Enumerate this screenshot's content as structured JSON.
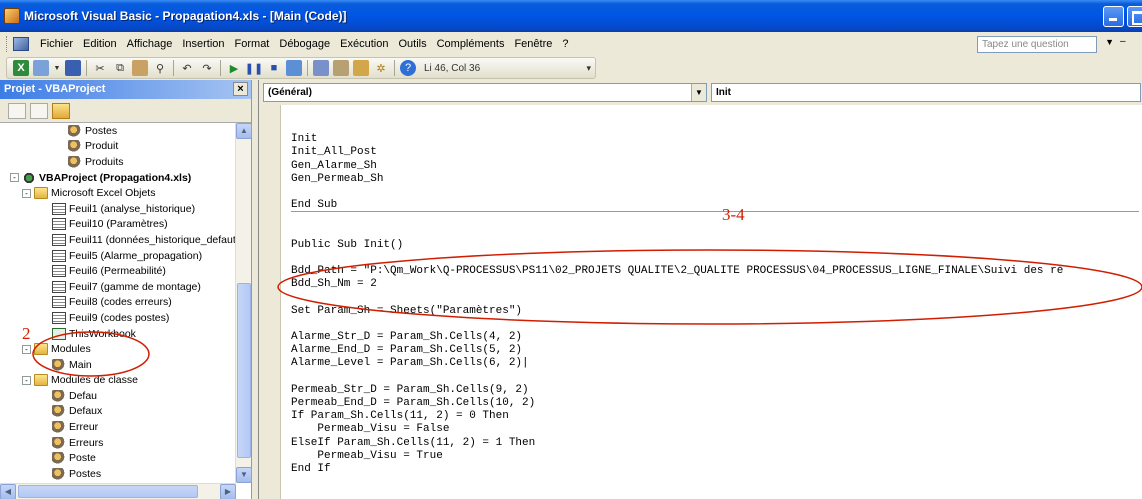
{
  "window": {
    "title": "Microsoft Visual Basic - Propagation4.xls - [Main (Code)]"
  },
  "menu": {
    "items": [
      "Fichier",
      "Edition",
      "Affichage",
      "Insertion",
      "Format",
      "Débogage",
      "Exécution",
      "Outils",
      "Compléments",
      "Fenêtre",
      "?"
    ],
    "question_placeholder": "Tapez une question"
  },
  "toolbar": {
    "position": "Li 46, Col 36"
  },
  "project": {
    "title": "Projet - VBAProject",
    "tree": [
      {
        "label": "Postes",
        "icon": "module-icon",
        "level": 3
      },
      {
        "label": "Produit",
        "icon": "module-icon",
        "level": 3
      },
      {
        "label": "Produits",
        "icon": "module-icon",
        "level": 3
      },
      {
        "label": "VBAProject (Propagation4.xls)",
        "icon": "project-icon",
        "level": 0,
        "bold": true,
        "expander": "-"
      },
      {
        "label": "Microsoft Excel Objets",
        "icon": "folder-icon",
        "level": 1,
        "expander": "-"
      },
      {
        "label": "Feuil1 (analyse_historique)",
        "icon": "sheet-icon",
        "level": 2
      },
      {
        "label": "Feuil10 (Paramètres)",
        "icon": "sheet-icon",
        "level": 2
      },
      {
        "label": "Feuil11 (données_historique_defaut",
        "icon": "sheet-icon",
        "level": 2
      },
      {
        "label": "Feuil5 (Alarme_propagation)",
        "icon": "sheet-icon",
        "level": 2
      },
      {
        "label": "Feuil6 (Permeabilité)",
        "icon": "sheet-icon",
        "level": 2
      },
      {
        "label": "Feuil7 (gamme de montage)",
        "icon": "sheet-icon",
        "level": 2
      },
      {
        "label": "Feuil8 (codes erreurs)",
        "icon": "sheet-icon",
        "level": 2
      },
      {
        "label": "Feuil9 (codes postes)",
        "icon": "sheet-icon",
        "level": 2
      },
      {
        "label": "ThisWorkbook",
        "icon": "workbook-icon",
        "level": 2
      },
      {
        "label": "Modules",
        "icon": "folder-icon",
        "level": 1,
        "expander": "-"
      },
      {
        "label": "Main",
        "icon": "module-icon",
        "level": 2
      },
      {
        "label": "Modules de classe",
        "icon": "folder-icon",
        "level": 1,
        "expander": "-"
      },
      {
        "label": "Defau",
        "icon": "module-icon",
        "level": 2
      },
      {
        "label": "Defaux",
        "icon": "module-icon",
        "level": 2
      },
      {
        "label": "Erreur",
        "icon": "module-icon",
        "level": 2
      },
      {
        "label": "Erreurs",
        "icon": "module-icon",
        "level": 2
      },
      {
        "label": "Poste",
        "icon": "module-icon",
        "level": 2
      },
      {
        "label": "Postes",
        "icon": "module-icon",
        "level": 2
      },
      {
        "label": "Produit",
        "icon": "module-icon",
        "level": 2
      },
      {
        "label": "Produits",
        "icon": "module-icon",
        "level": 2
      }
    ]
  },
  "code": {
    "object_combo": "(Général)",
    "procedure_combo": "Init",
    "lines": [
      {
        "text": ""
      },
      {
        "text": "Init"
      },
      {
        "text": "Init_All_Post"
      },
      {
        "text": "Gen_Alarme_Sh"
      },
      {
        "text": "Gen_Permeab_Sh"
      },
      {
        "text": ""
      },
      {
        "text": "End Sub",
        "sep": true
      },
      {
        "text": ""
      },
      {
        "text": ""
      },
      {
        "text": "Public Sub Init()"
      },
      {
        "text": ""
      },
      {
        "text": "Bdd_Path = \"P:\\Qm_Work\\Q-PROCESSUS\\PS11\\02_PROJETS QUALITE\\2_QUALITE PROCESSUS\\04_PROCESSUS_LIGNE_FINALE\\Suivi des ré"
      },
      {
        "text": "Bdd_Sh_Nm = 2"
      },
      {
        "text": ""
      },
      {
        "text": "Set Param_Sh = Sheets(\"Paramètres\")"
      },
      {
        "text": ""
      },
      {
        "text": "Alarme_Str_D = Param_Sh.Cells(4, 2)"
      },
      {
        "text": "Alarme_End_D = Param_Sh.Cells(5, 2)"
      },
      {
        "text": "Alarme_Level = Param_Sh.Cells(6, 2)|"
      },
      {
        "text": ""
      },
      {
        "text": "Permeab_Str_D = Param_Sh.Cells(9, 2)"
      },
      {
        "text": "Permeab_End_D = Param_Sh.Cells(10, 2)"
      },
      {
        "text": "If Param_Sh.Cells(11, 2) = 0 Then"
      },
      {
        "text": "    Permeab_Visu = False"
      },
      {
        "text": "ElseIf Param_Sh.Cells(11, 2) = 1 Then"
      },
      {
        "text": "    Permeab_Visu = True"
      },
      {
        "text": "End If"
      }
    ]
  },
  "annotations": {
    "label_a": "2",
    "label_b": "3-4",
    "color": "#d11d00"
  }
}
